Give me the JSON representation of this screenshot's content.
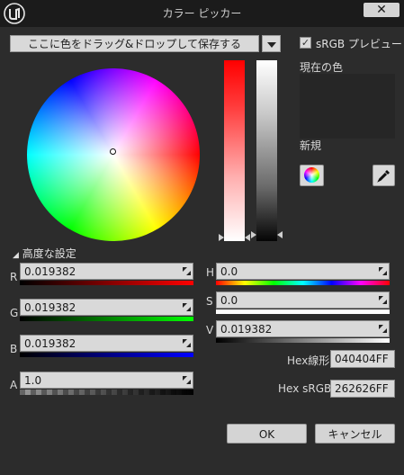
{
  "window": {
    "title": "カラー ピッカー",
    "close_label": "✕"
  },
  "drop_field": {
    "label": "ここに色をドラッグ&ドロップして保存する"
  },
  "srgb_preview": {
    "label": "sRGB プレビュー",
    "checked": true,
    "check_glyph": "✓"
  },
  "preview": {
    "current_label": "現在の色",
    "new_label": "新規",
    "current_color": "#262626",
    "new_color": "#262626"
  },
  "advanced": {
    "toggle_glyph": "◢",
    "label": "高度な設定"
  },
  "channels_left": [
    {
      "label": "R",
      "value": "0.019382"
    },
    {
      "label": "G",
      "value": "0.019382"
    },
    {
      "label": "B",
      "value": "0.019382"
    },
    {
      "label": "A",
      "value": "1.0"
    }
  ],
  "channels_right": [
    {
      "label": "H",
      "value": "0.0"
    },
    {
      "label": "S",
      "value": "0.0"
    },
    {
      "label": "V",
      "value": "0.019382"
    }
  ],
  "hex": {
    "linear_label": "Hex線形",
    "linear_value": "040404FF",
    "srgb_label": "Hex sRGB",
    "srgb_value": "262626FF"
  },
  "buttons": {
    "ok": "OK",
    "cancel": "キャンセル"
  },
  "icons": {
    "logo": "unreal-logo-icon",
    "eyedropper": "eyedropper-icon",
    "color_wheel": "color-wheel-icon"
  }
}
